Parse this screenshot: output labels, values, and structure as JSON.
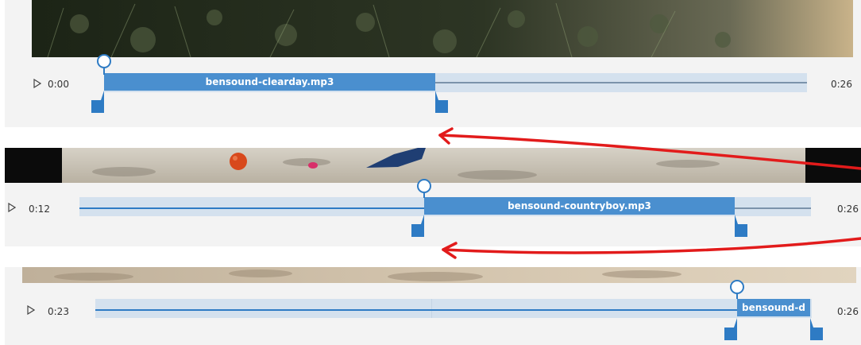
{
  "panels": [
    {
      "start_time": "0:00",
      "end_time": "0:26",
      "clip_name": "bensound-clearday.mp3"
    },
    {
      "start_time": "0:12",
      "end_time": "0:26",
      "clip_name": "bensound-countryboy.mp3"
    },
    {
      "start_time": "0:23",
      "end_time": "0:26",
      "clip_name": "bensound-d"
    }
  ],
  "colors": {
    "clip": "#4a8fcf",
    "track": "#d4e1ee",
    "handle": "#2e7bc4",
    "arrow": "#e21b1b"
  },
  "icons": [
    "play-icon",
    "trim-handle-start",
    "trim-handle-end",
    "playhead-icon"
  ]
}
